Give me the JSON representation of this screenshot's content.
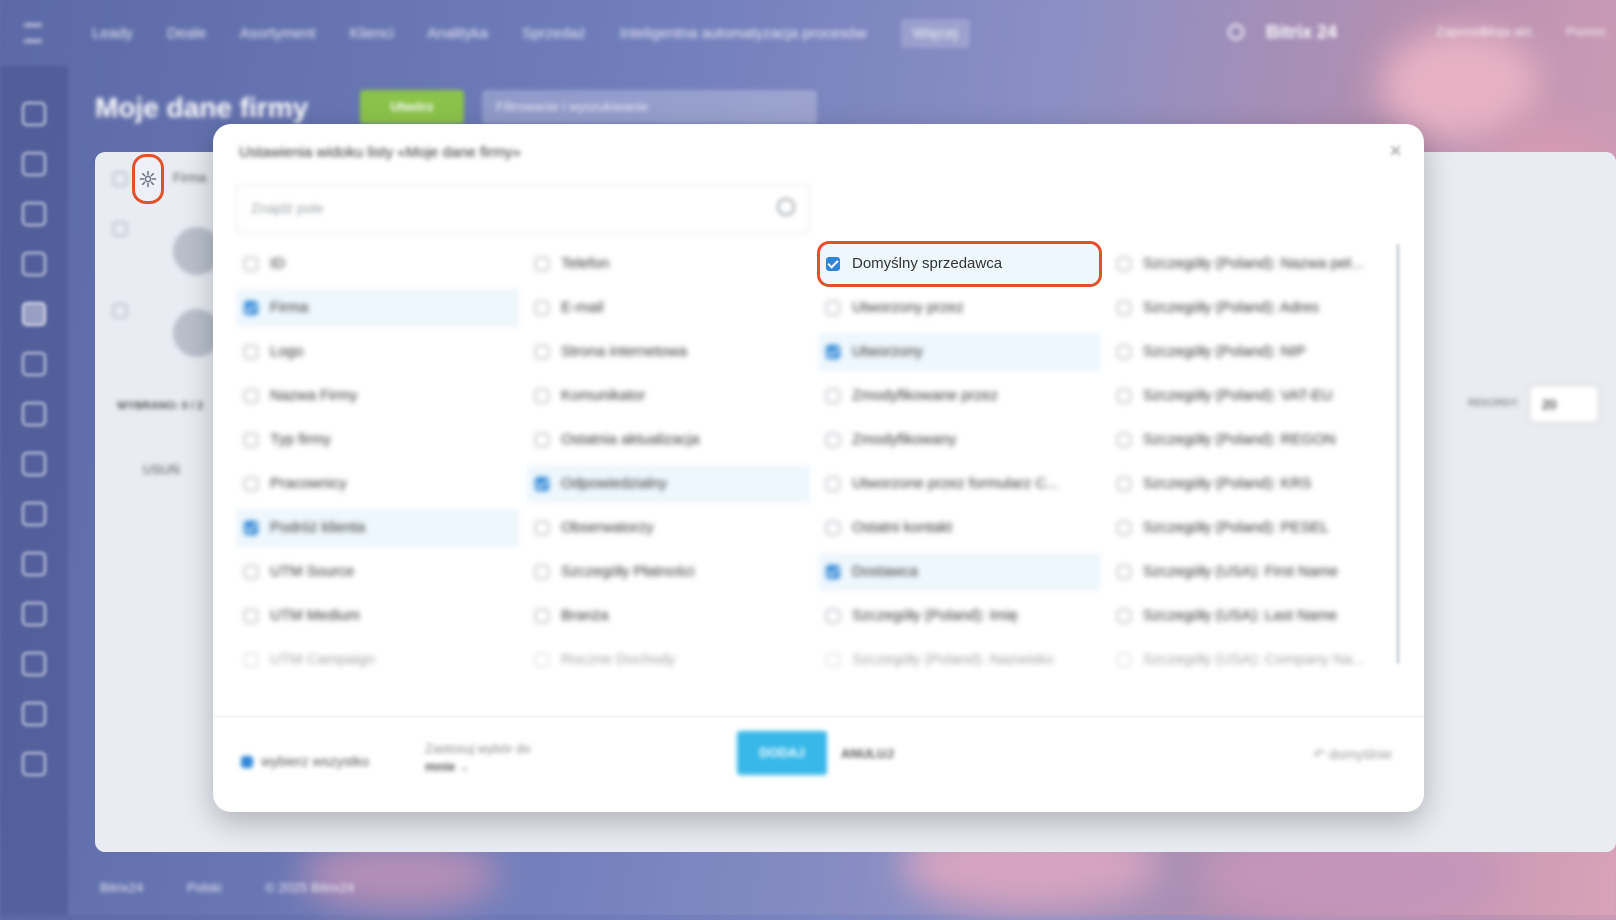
{
  "topbar": {
    "nav": [
      "Leady",
      "Deale",
      "Asortyment",
      "Klienci",
      "Analityka",
      "Sprzedaż",
      "Inteligentna automatyzacja procesów",
      "Więcej"
    ],
    "brand": "Bitrix 24",
    "right": [
      "Zaprosić",
      "Moja akt.",
      "Pomoc"
    ]
  },
  "page": {
    "title": "Moje dane firmy",
    "add_button": "Utwórz",
    "filter_placeholder": "Filtrowanie i wyszukiwanie",
    "col_header": "Firma",
    "selected": "WYBRANO: 0 / 2",
    "delete_label": "USUŃ",
    "records_label": "REKORDY:",
    "records_value": "20"
  },
  "footer": {
    "brand": "Bitrix24",
    "language": "Polski",
    "copyright": "© 2025 Bitrix24"
  },
  "modal": {
    "title": "Ustawienia widoku listy «Moje dane firmy»",
    "search_placeholder": "Znajdź pole",
    "columns": [
      [
        {
          "label": "ID",
          "checked": false
        },
        {
          "label": "Firma",
          "checked": true
        },
        {
          "label": "Logo",
          "checked": false
        },
        {
          "label": "Nazwa Firmy",
          "checked": false
        },
        {
          "label": "Typ firmy",
          "checked": false
        },
        {
          "label": "Pracownicy",
          "checked": false
        },
        {
          "label": "Podróż klienta",
          "checked": true
        },
        {
          "label": "UTM Source",
          "checked": false
        },
        {
          "label": "UTM Medium",
          "checked": false
        },
        {
          "label": "UTM Campaign",
          "checked": false
        }
      ],
      [
        {
          "label": "Telefon",
          "checked": false
        },
        {
          "label": "E-mail",
          "checked": false
        },
        {
          "label": "Strona internetowa",
          "checked": false
        },
        {
          "label": "Komunikator",
          "checked": false
        },
        {
          "label": "Ostatnia aktualizacja",
          "checked": false
        },
        {
          "label": "Odpowiedzialny",
          "checked": true
        },
        {
          "label": "Obserwatorzy",
          "checked": false
        },
        {
          "label": "Szczegóły Płatności",
          "checked": false
        },
        {
          "label": "Branża",
          "checked": false
        },
        {
          "label": "Roczne Dochody",
          "checked": false
        }
      ],
      [
        {
          "label": "Domyślny sprzedawca",
          "checked": true
        },
        {
          "label": "Utworzony przez",
          "checked": false
        },
        {
          "label": "Utworzony",
          "checked": true
        },
        {
          "label": "Zmodyfikowane przez",
          "checked": false
        },
        {
          "label": "Zmodyfikowany",
          "checked": false
        },
        {
          "label": "Utworzone przez formularz C...",
          "checked": false
        },
        {
          "label": "Ostatni kontakt",
          "checked": false
        },
        {
          "label": "Dostawca",
          "checked": true
        },
        {
          "label": "Szczegóły (Poland): Imię",
          "checked": false
        },
        {
          "label": "Szczegóły (Poland): Nazwisko",
          "checked": false
        }
      ],
      [
        {
          "label": "Szczegóły (Poland): Nazwa peł...",
          "checked": false
        },
        {
          "label": "Szczegóły (Poland): Adres",
          "checked": false
        },
        {
          "label": "Szczegóły (Poland): NIP",
          "checked": false
        },
        {
          "label": "Szczegóły (Poland): VAT-EU",
          "checked": false
        },
        {
          "label": "Szczegóły (Poland): REGON",
          "checked": false
        },
        {
          "label": "Szczegóły (Poland): KRS",
          "checked": false
        },
        {
          "label": "Szczegóły (Poland): PESEL",
          "checked": false
        },
        {
          "label": "Szczegóły (USA): First Name",
          "checked": false
        },
        {
          "label": "Szczegóły (USA): Last Name",
          "checked": false
        },
        {
          "label": "Szczegóły (USA): Company Na...",
          "checked": false
        }
      ]
    ],
    "select_all": "wybierz wszystko",
    "apply_to_label": "Zastosuj wybór do",
    "apply_to_value": "mnie",
    "add_button": "DODAJ",
    "cancel_button": "ANULUJ",
    "reset_button": "domyślnie"
  },
  "colors": {
    "accent": "#2d86d7",
    "highlight": "#e2512c",
    "add_button": "#37b8e8"
  }
}
